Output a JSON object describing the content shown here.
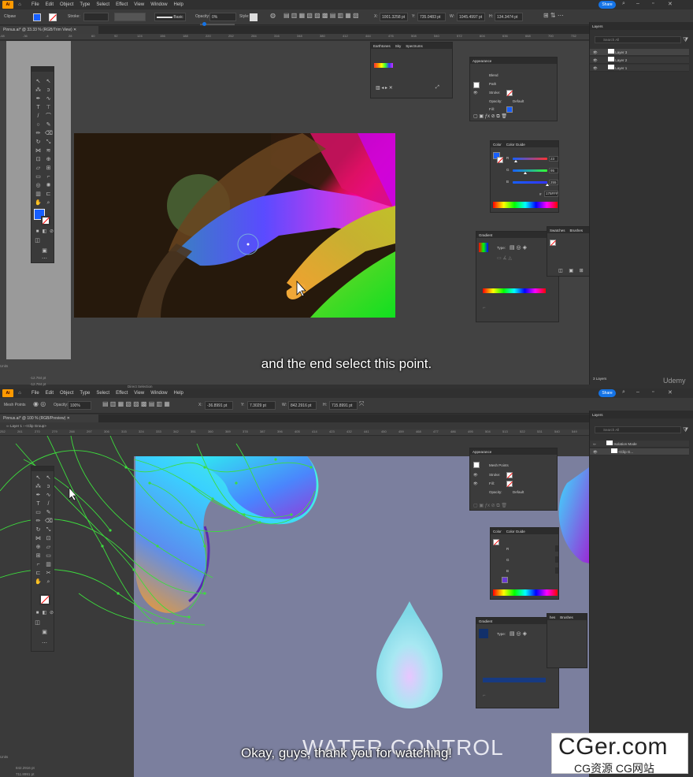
{
  "top": {
    "menubar": {
      "logo": "Ai",
      "items": [
        "File",
        "Edit",
        "Object",
        "Type",
        "Select",
        "Effect",
        "View",
        "Window",
        "Help"
      ],
      "share": "Share"
    },
    "control": {
      "selection": "Clipaw",
      "stroke_label": "Stroke:",
      "brush_label": "Basic",
      "opacity_label": "Opacity:",
      "opacity_value": "0%",
      "style_label": "Style:",
      "x_value": "1001.3258 pt",
      "y_value": "735.0483 pt",
      "w_value": "1045.4997 pt",
      "h_value": "134.3474 pt"
    },
    "doc_tab": "Pinnus.ai* @ 33.33 % (RGB/Trim View)",
    "ruler": [
      "-68",
      "-36",
      "-4",
      "28",
      "60",
      "92",
      "124",
      "156",
      "188",
      "220",
      "252",
      "284",
      "316",
      "348",
      "380",
      "412",
      "444",
      "476",
      "508",
      "540",
      "572",
      "604",
      "636",
      "668",
      "700",
      "732"
    ],
    "symbols_panel": {
      "tabs": [
        "Earthtones",
        "Sky",
        "Spectrums"
      ]
    },
    "appearance": {
      "title": "Appearance",
      "type": "Path",
      "header": "Blend",
      "stroke": "Stroke:",
      "opacity": "Opacity:",
      "opacity_value": "Default",
      "fill": "Fill:"
    },
    "color": {
      "tabs": [
        "Color",
        "Color Guide"
      ],
      "channels": [
        {
          "label": "R",
          "value": "23",
          "fill": 0.09
        },
        {
          "label": "G",
          "value": "95",
          "fill": 0.37
        },
        {
          "label": "B",
          "value": "255",
          "fill": 1.0
        }
      ],
      "hex_symbol": "#",
      "hex": "175FFF"
    },
    "pathfinder": {
      "tabs": [
        "Transform",
        "Align",
        "Pathfinder"
      ],
      "shape_modes": "Shape Modes:",
      "expand": "Expand",
      "pathfinders": "Pathfinders:"
    },
    "gradient": {
      "title": "Gradient",
      "type": "Type:"
    },
    "swatches": {
      "tabs": [
        "Swatches",
        "Brushes"
      ]
    },
    "layers": {
      "title": "Layers",
      "search": "Search All",
      "items": [
        "Layer 3",
        "Layer 2",
        "Layer 1"
      ],
      "count": "3 Layers"
    },
    "status": {
      "left": "Units",
      "x": "-12.784 pt",
      "y": "-12.784 pt",
      "tool": "Direct Selection"
    },
    "caption": "and the end select this point.",
    "watermark": "Udemy"
  },
  "bottom": {
    "menubar": {
      "logo": "Ai",
      "items": [
        "File",
        "Edit",
        "Object",
        "Type",
        "Select",
        "Effect",
        "View",
        "Window",
        "Help"
      ],
      "share": "Share"
    },
    "control": {
      "selection": "Mesh Points",
      "opacity_label": "Opacity:",
      "opacity_value": "100%",
      "x_value": "-36.8991 pt",
      "y_value": "7.3029 pt",
      "w_value": "842.2916 pt",
      "h_value": "715.8991 pt"
    },
    "doc_tab": "Pinnus.ai* @ 100 % (RGB/Preview)",
    "breadcrumb": [
      "Layer 1",
      "<Clip Group>"
    ],
    "ruler": [
      "252",
      "261",
      "270",
      "279",
      "288",
      "297",
      "306",
      "315",
      "324",
      "333",
      "342",
      "351",
      "360",
      "369",
      "378",
      "387",
      "396",
      "405",
      "414",
      "423",
      "432",
      "441",
      "450",
      "459",
      "468",
      "477",
      "486",
      "495",
      "504",
      "513",
      "522",
      "531",
      "540",
      "549"
    ],
    "appearance": {
      "title": "Appearance",
      "type": "Mesh Points",
      "stroke": "Stroke:",
      "fill": "Fill:",
      "opacity": "Opacity:",
      "opacity_value": "Default"
    },
    "color": {
      "tabs": [
        "Color",
        "Color Guide"
      ],
      "channels": [
        "R",
        "G",
        "B"
      ]
    },
    "gradient": {
      "title": "Gradient",
      "type": "Type:"
    },
    "swatches": {
      "tabs": [
        "hes",
        "Brushes"
      ]
    },
    "layers": {
      "title": "Layers",
      "search": "Search All",
      "items": [
        "Isolation Mode",
        "<Clip G..."
      ]
    },
    "status": {
      "left": "Units",
      "x": "842.2916 pt",
      "y": "711.8991 pt"
    },
    "canvas_text": "WATER CONTROL",
    "caption": "Okay, guys, thank you for watching!"
  },
  "site_watermark": {
    "main": "CGer.com",
    "sub": "CG资源 CG网站"
  },
  "colors": {
    "ui_dark": "#323232",
    "panel": "#3b3b3b",
    "accent_blue": "#1473e6",
    "fill_blue": "#175FFF",
    "mesh_green": "#3ddc3d",
    "artboard": "#7b7f9e"
  }
}
